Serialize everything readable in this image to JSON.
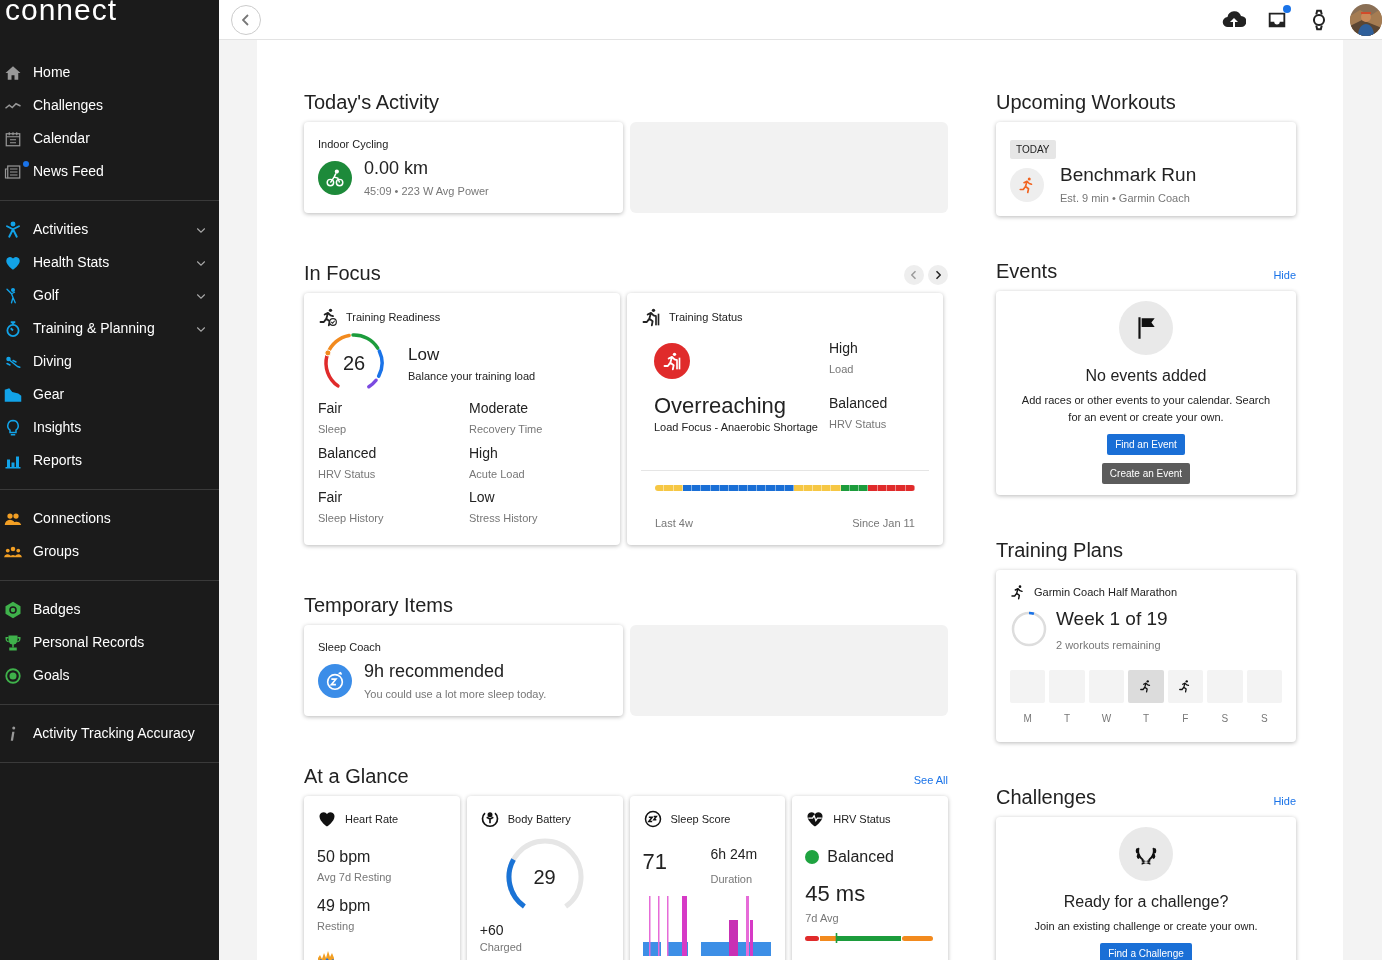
{
  "sidebar": {
    "logo": "connect",
    "sections": [
      {
        "items": [
          {
            "label": "Home",
            "unread": false,
            "submenu": false
          },
          {
            "label": "Challenges",
            "unread": false,
            "submenu": false
          },
          {
            "label": "Calendar",
            "unread": false,
            "submenu": false
          },
          {
            "label": "News Feed",
            "unread": true,
            "submenu": false
          }
        ]
      },
      {
        "items": [
          {
            "label": "Activities",
            "unread": false,
            "submenu": true
          },
          {
            "label": "Health Stats",
            "unread": false,
            "submenu": true
          },
          {
            "label": "Golf",
            "unread": false,
            "submenu": true
          },
          {
            "label": "Training & Planning",
            "unread": false,
            "submenu": true
          },
          {
            "label": "Diving",
            "unread": false,
            "submenu": false
          },
          {
            "label": "Gear",
            "unread": false,
            "submenu": false
          },
          {
            "label": "Insights",
            "unread": false,
            "submenu": false
          },
          {
            "label": "Reports",
            "unread": false,
            "submenu": false
          }
        ]
      },
      {
        "items": [
          {
            "label": "Connections",
            "unread": false,
            "submenu": false
          },
          {
            "label": "Groups",
            "unread": false,
            "submenu": false
          }
        ]
      },
      {
        "items": [
          {
            "label": "Badges",
            "unread": false,
            "submenu": false
          },
          {
            "label": "Personal Records",
            "unread": false,
            "submenu": false
          },
          {
            "label": "Goals",
            "unread": false,
            "submenu": false
          }
        ]
      },
      {
        "items": [
          {
            "label": "Activity Tracking Accuracy",
            "unread": false,
            "submenu": false
          }
        ]
      }
    ]
  },
  "topbar": {
    "inbox_unread": true
  },
  "today_activity": {
    "title": "Today's Activity",
    "cards": [
      {
        "kind": "cycling",
        "title": "Indoor Cycling",
        "value": "0.00 km",
        "detail": "45:09 • 223 W Avg Power"
      },
      {
        "kind": "placeholder"
      }
    ]
  },
  "in_focus": {
    "title": "In Focus",
    "prev_enabled": false,
    "next_enabled": true,
    "training_readiness": {
      "title": "Training Readiness",
      "score": "26",
      "status": "Low",
      "message": "Balance your training load",
      "metrics": [
        {
          "value": "Fair",
          "label": "Sleep"
        },
        {
          "value": "Moderate",
          "label": "Recovery Time"
        },
        {
          "value": "Balanced",
          "label": "HRV Status"
        },
        {
          "value": "High",
          "label": "Acute Load"
        },
        {
          "value": "Fair",
          "label": "Sleep History"
        },
        {
          "value": "Low",
          "label": "Stress History"
        }
      ]
    },
    "training_status": {
      "title": "Training Status",
      "status": "Overreaching",
      "detail": "Load Focus - Anaerobic Shortage",
      "metrics": [
        {
          "value": "High",
          "label": "Load"
        },
        {
          "value": "Balanced",
          "label": "HRV Status"
        }
      ],
      "history": [
        {
          "color": "#f6c744"
        },
        {
          "color": "#f6c744"
        },
        {
          "color": "#f6c744"
        },
        {
          "color": "#1a6fd6"
        },
        {
          "color": "#1a6fd6"
        },
        {
          "color": "#1a6fd6"
        },
        {
          "color": "#1a6fd6"
        },
        {
          "color": "#1a6fd6"
        },
        {
          "color": "#1a6fd6"
        },
        {
          "color": "#1a6fd6"
        },
        {
          "color": "#1a6fd6"
        },
        {
          "color": "#1a6fd6"
        },
        {
          "color": "#1a6fd6"
        },
        {
          "color": "#1a6fd6"
        },
        {
          "color": "#1a6fd6"
        },
        {
          "color": "#f6c744"
        },
        {
          "color": "#f6c744"
        },
        {
          "color": "#f6c744"
        },
        {
          "color": "#f6c744"
        },
        {
          "color": "#f6c744"
        },
        {
          "color": "#1c9c3c"
        },
        {
          "color": "#1c9c3c"
        },
        {
          "color": "#1c9c3c"
        },
        {
          "color": "#e02b2b"
        },
        {
          "color": "#e02b2b"
        },
        {
          "color": "#e02b2b"
        },
        {
          "color": "#e02b2b"
        },
        {
          "color": "#e02b2b"
        }
      ],
      "range_start": "Last 4w",
      "range_end": "Since Jan 11"
    }
  },
  "temporary_items": {
    "title": "Temporary Items",
    "cards": [
      {
        "kind": "sleep",
        "title": "Sleep Coach",
        "value": "9h recommended",
        "detail": "You could use a lot more sleep today."
      },
      {
        "kind": "placeholder"
      }
    ]
  },
  "at_a_glance": {
    "title": "At a Glance",
    "link": "See All",
    "heart_rate": {
      "title": "Heart Rate",
      "metrics": [
        {
          "value": "50 bpm",
          "label": "Avg 7d Resting"
        },
        {
          "value": "49 bpm",
          "label": "Resting"
        }
      ]
    },
    "body_battery": {
      "title": "Body Battery",
      "value": "29",
      "charged": "+60",
      "charged_label": "Charged"
    },
    "sleep_score": {
      "title": "Sleep Score",
      "score": "71",
      "duration": "6h 24m",
      "duration_label": "Duration"
    },
    "hrv_status": {
      "title": "HRV Status",
      "status": "Balanced",
      "color": "#1fa340",
      "value": "45 ms",
      "value_label": "7d Avg",
      "level": 0.24
    }
  },
  "upcoming_workouts": {
    "title": "Upcoming Workouts",
    "cards": [
      {
        "badge": "TODAY",
        "title": "Benchmark Run",
        "detail": "Est. 9 min • Garmin Coach"
      }
    ]
  },
  "events": {
    "title": "Events",
    "link": "Hide",
    "empty_title": "No events added",
    "empty_text": "Add races or other events to your calendar. Search for an event or create your own.",
    "buttons": [
      {
        "label": "Find an Event",
        "kind": "primary"
      },
      {
        "label": "Create an Event",
        "kind": "secondary"
      }
    ]
  },
  "training_plans": {
    "title": "Training Plans",
    "plan": "Garmin Coach Half Marathon",
    "week": "Week 1 of 19",
    "remaining": "2 workouts remaining",
    "level": 0.05,
    "days": [
      {
        "label": "M",
        "workout": false,
        "selected": false
      },
      {
        "label": "T",
        "workout": false,
        "selected": false
      },
      {
        "label": "W",
        "workout": false,
        "selected": false
      },
      {
        "label": "T",
        "workout": true,
        "selected": true
      },
      {
        "label": "F",
        "workout": true,
        "selected": false
      },
      {
        "label": "S",
        "workout": false,
        "selected": false
      },
      {
        "label": "S",
        "workout": false,
        "selected": false
      }
    ]
  },
  "challenges": {
    "title": "Challenges",
    "link": "Hide",
    "empty_title": "Ready for a challenge?",
    "empty_text": "Join an existing challenge or create your own.",
    "buttons": [
      {
        "label": "Find a Challenge",
        "kind": "primary"
      }
    ]
  }
}
